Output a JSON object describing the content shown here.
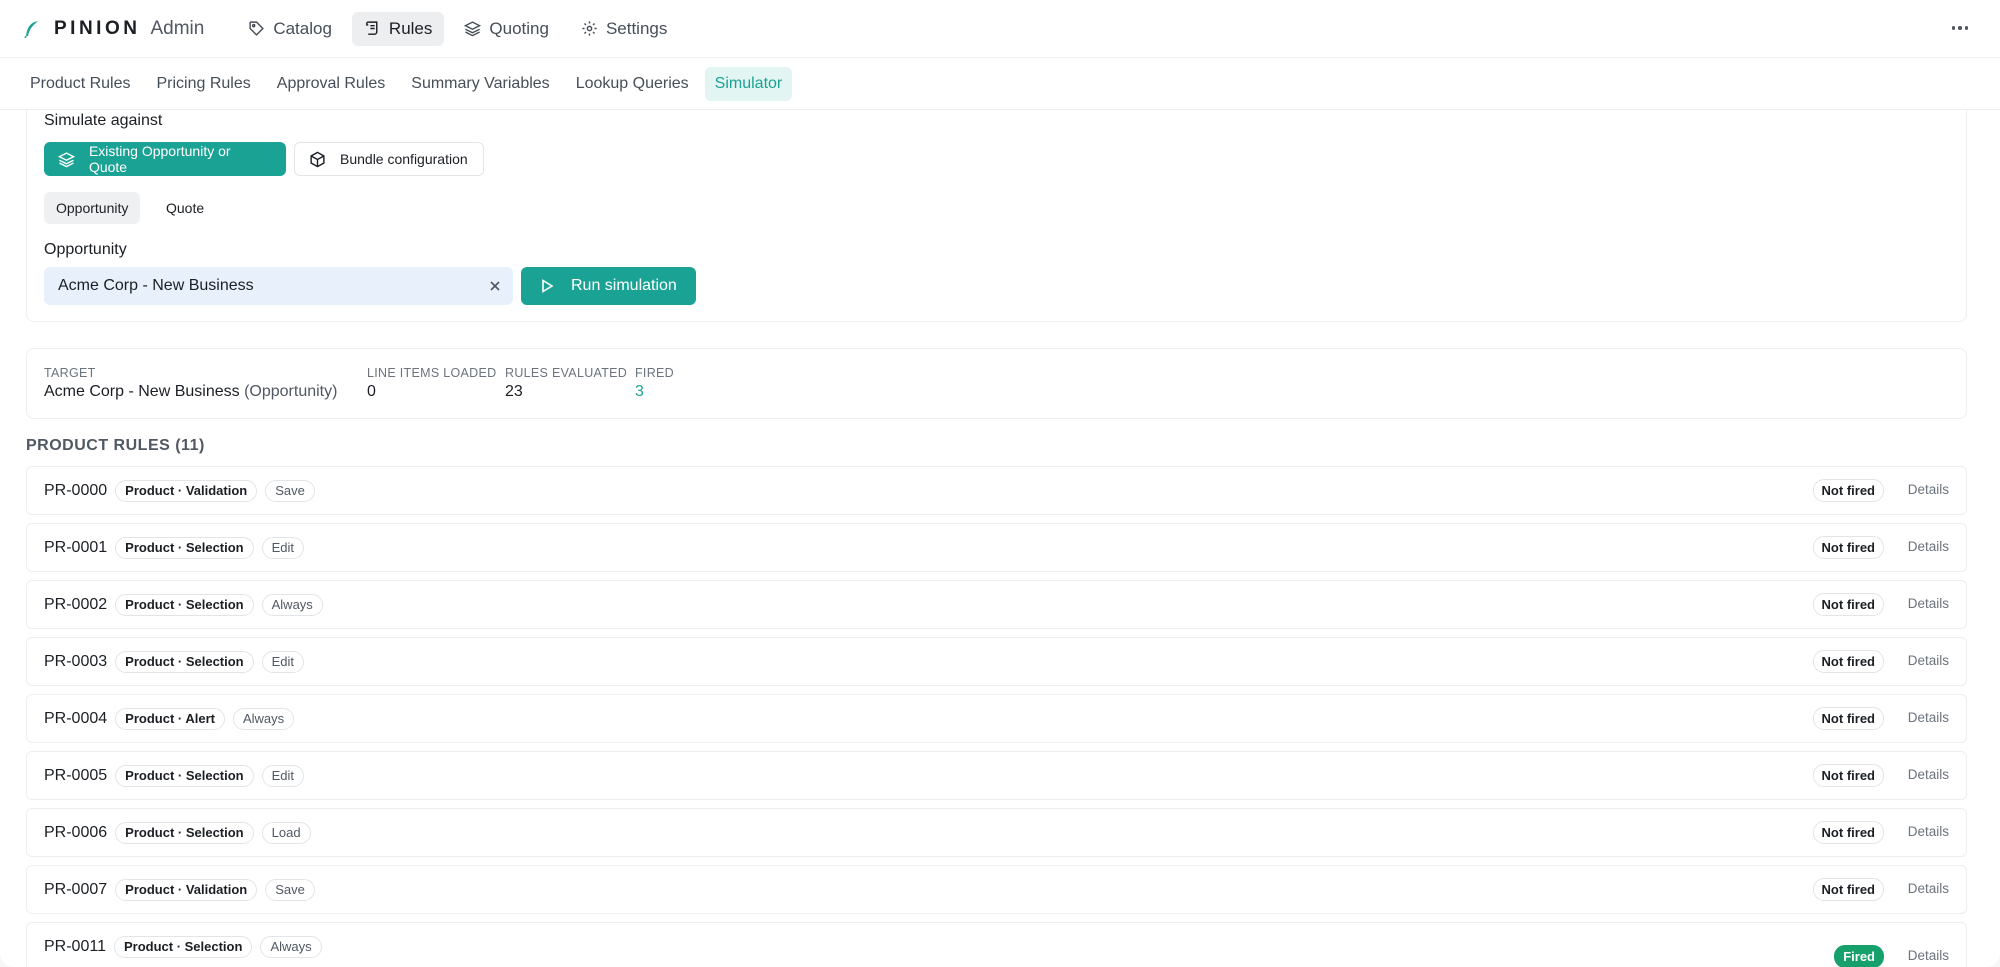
{
  "app": {
    "brand": "PINION",
    "section": "Admin"
  },
  "topnav": [
    {
      "label": "Catalog",
      "icon": "tag-icon",
      "active": false
    },
    {
      "label": "Rules",
      "icon": "scroll-icon",
      "active": true
    },
    {
      "label": "Quoting",
      "icon": "layers-icon",
      "active": false
    },
    {
      "label": "Settings",
      "icon": "gear-icon",
      "active": false
    }
  ],
  "subnav": [
    {
      "label": "Product Rules",
      "active": false
    },
    {
      "label": "Pricing Rules",
      "active": false
    },
    {
      "label": "Approval Rules",
      "active": false
    },
    {
      "label": "Summary Variables",
      "active": false
    },
    {
      "label": "Lookup Queries",
      "active": false
    },
    {
      "label": "Simulator",
      "active": true
    }
  ],
  "simulator": {
    "simulate_against_label": "Simulate against",
    "mode_existing": "Existing Opportunity or Quote",
    "mode_bundle": "Bundle configuration",
    "segment_opportunity": "Opportunity",
    "segment_quote": "Quote",
    "opportunity_label": "Opportunity",
    "opportunity_value": "Acme Corp - New Business",
    "run_label": "Run simulation"
  },
  "summary": {
    "target_label": "TARGET",
    "target_value": "Acme Corp - New Business",
    "target_type": "(Opportunity)",
    "line_items_label": "LINE ITEMS LOADED",
    "line_items_value": "0",
    "rules_evaluated_label": "RULES EVALUATED",
    "rules_evaluated_value": "23",
    "fired_label": "FIRED",
    "fired_value": "3"
  },
  "product_rules": {
    "title": "PRODUCT RULES (11)",
    "details_label": "Details",
    "rows": [
      {
        "id": "PR-0000",
        "type": "Product · Validation",
        "trigger": "Save",
        "status": "Not fired"
      },
      {
        "id": "PR-0001",
        "type": "Product · Selection",
        "trigger": "Edit",
        "status": "Not fired"
      },
      {
        "id": "PR-0002",
        "type": "Product · Selection",
        "trigger": "Always",
        "status": "Not fired"
      },
      {
        "id": "PR-0003",
        "type": "Product · Selection",
        "trigger": "Edit",
        "status": "Not fired"
      },
      {
        "id": "PR-0004",
        "type": "Product · Alert",
        "trigger": "Always",
        "status": "Not fired"
      },
      {
        "id": "PR-0005",
        "type": "Product · Selection",
        "trigger": "Edit",
        "status": "Not fired"
      },
      {
        "id": "PR-0006",
        "type": "Product · Selection",
        "trigger": "Load",
        "status": "Not fired"
      },
      {
        "id": "PR-0007",
        "type": "Product · Validation",
        "trigger": "Save",
        "status": "Not fired"
      },
      {
        "id": "PR-0011",
        "type": "Product · Selection",
        "trigger": "Always",
        "status": "Fired"
      }
    ]
  },
  "colors": {
    "accent": "#1aa394",
    "fired": "#16a06b",
    "input_bg": "#e8f1fb"
  }
}
